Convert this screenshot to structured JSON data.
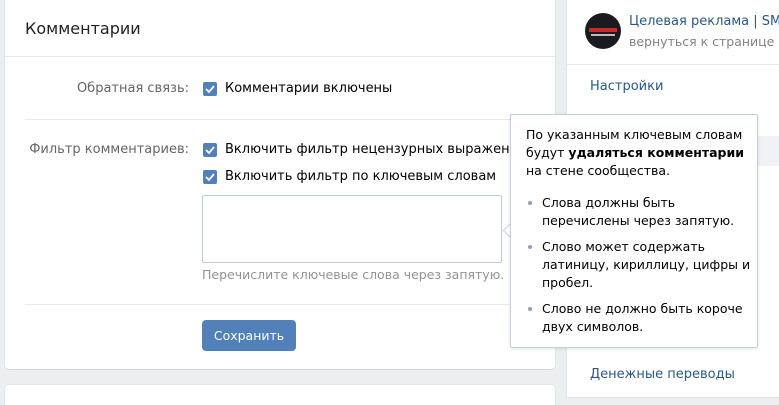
{
  "panel": {
    "title": "Комментарии",
    "feedback": {
      "label": "Обратная связь:",
      "checkbox_label": "Комментарии включены",
      "checked": true
    },
    "filter": {
      "label": "Фильтр комментариев:",
      "obscene_label": "Включить фильтр нецензурных выражений",
      "obscene_checked": true,
      "keywords_label": "Включить фильтр по ключевым словам",
      "keywords_checked": true,
      "keywords_value": "",
      "hint": "Перечислите ключевые слова через запятую."
    },
    "save_label": "Сохранить"
  },
  "sidebar": {
    "group_name": "Целевая реклама | SMM, ...",
    "back_label": "вернуться к странице",
    "items": [
      {
        "label": "Настройки"
      },
      {
        "label": "Денежные переводы"
      }
    ]
  },
  "tooltip": {
    "intro_pre": "По указанным ключевым словам будут",
    "intro_bold": "удаляться комментарии",
    "intro_post": "на стене сообщества.",
    "bullets": [
      "Слова должны быть перечислены через запятую.",
      "Слово может содержать латиницу, кириллицу, цифры и пробел.",
      "Слово не должно быть короче двух символов."
    ]
  },
  "colors": {
    "accent": "#5181b8",
    "link": "#2a5885",
    "page_bg": "#edeef0"
  }
}
